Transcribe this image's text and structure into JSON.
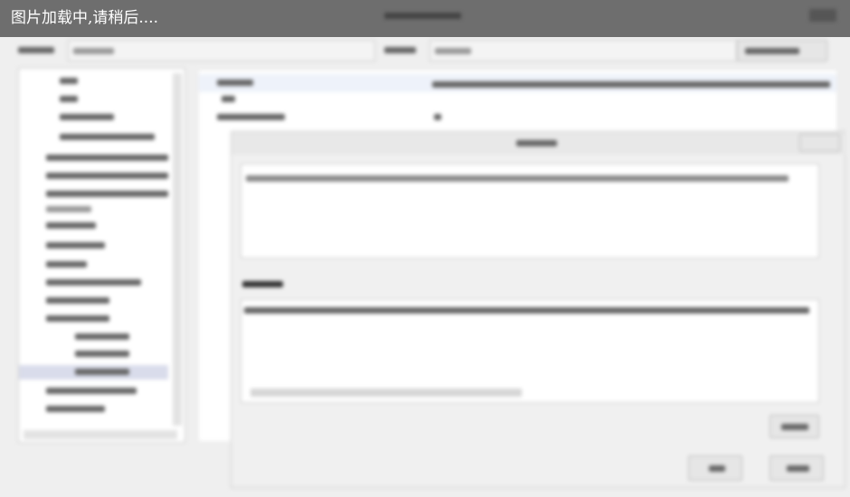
{
  "loading_overlay": {
    "text": "图片加载中,请稍后...."
  }
}
